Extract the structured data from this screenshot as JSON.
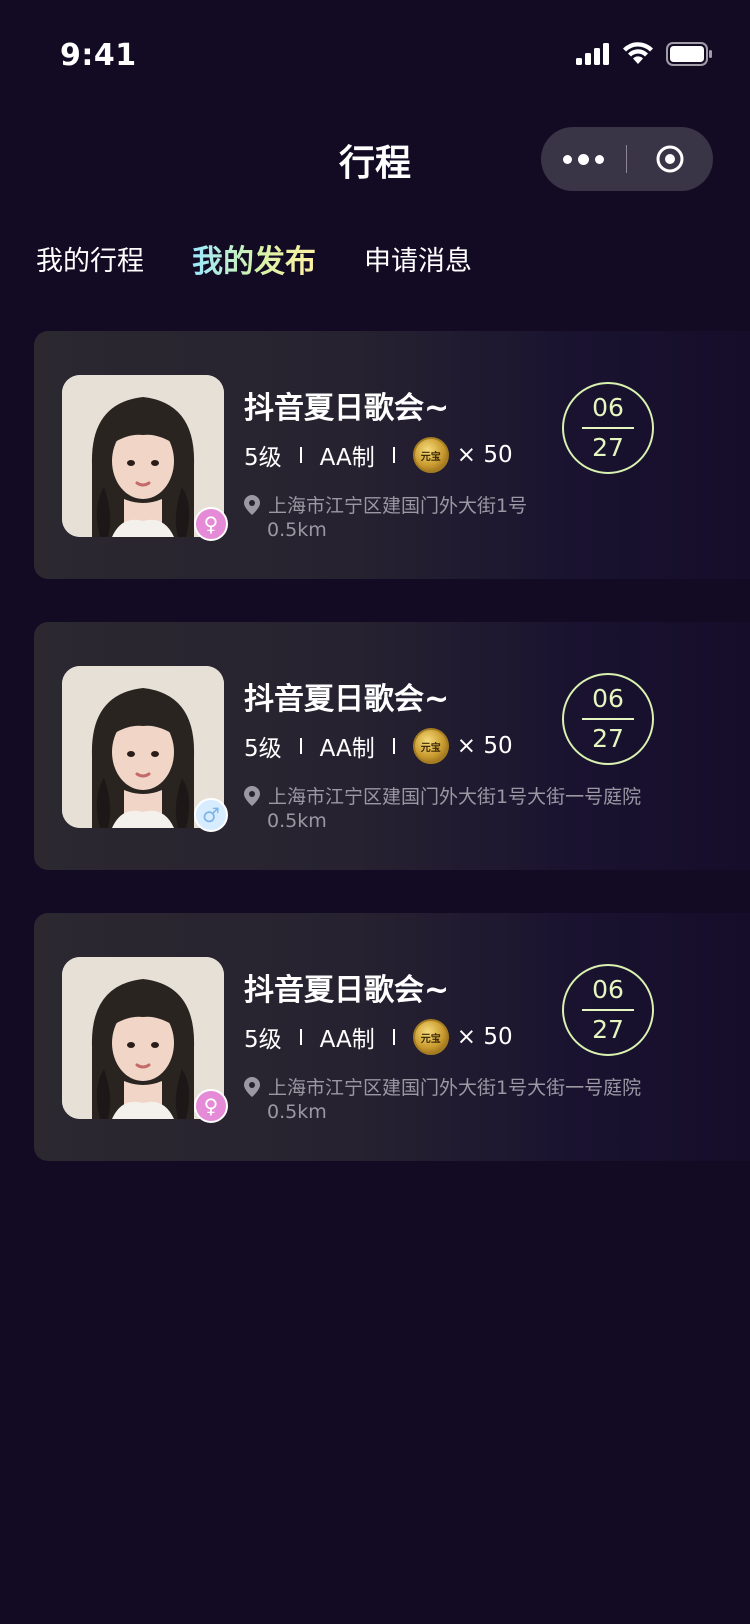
{
  "status": {
    "time": "9:41"
  },
  "nav": {
    "title": "行程"
  },
  "tabs": [
    {
      "label": "我的行程",
      "active": false
    },
    {
      "label": "我的发布",
      "active": true
    },
    {
      "label": "申请消息",
      "active": false
    }
  ],
  "cards": [
    {
      "title": "抖音夏日歌会~",
      "level": "5级",
      "pay": "AA制",
      "coin_count": "× 50",
      "address": "上海市江宁区建国门外大街1号",
      "distance": "0.5km",
      "month": "06",
      "day": "27",
      "gender": "female",
      "gender_glyph": "♀"
    },
    {
      "title": "抖音夏日歌会~",
      "level": "5级",
      "pay": "AA制",
      "coin_count": "× 50",
      "address": "上海市江宁区建国门外大街1号大街一号庭院",
      "distance": "0.5km",
      "month": "06",
      "day": "27",
      "gender": "male",
      "gender_glyph": "♂"
    },
    {
      "title": "抖音夏日歌会~",
      "level": "5级",
      "pay": "AA制",
      "coin_count": "× 50",
      "address": "上海市江宁区建国门外大街1号大街一号庭院",
      "distance": "0.5km",
      "month": "06",
      "day": "27",
      "gender": "female",
      "gender_glyph": "♀"
    }
  ],
  "colors": {
    "background": "#130b24",
    "accent_gradient_start": "#9be8ff",
    "accent_gradient_end": "#fff0a2",
    "date_ring": "#d9f2b0"
  },
  "icons": {
    "coin": "coin-icon",
    "location": "location-pin-icon",
    "more": "more-dots-icon",
    "close": "target-icon"
  }
}
